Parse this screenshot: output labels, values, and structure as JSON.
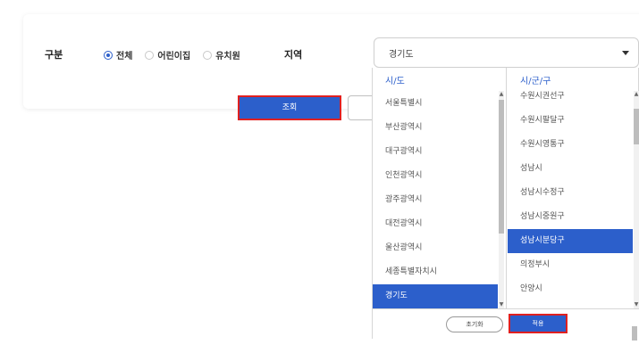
{
  "filter": {
    "category_label": "구분",
    "radio_options": [
      {
        "label": "전체",
        "checked": true
      },
      {
        "label": "어린이집",
        "checked": false
      },
      {
        "label": "유치원",
        "checked": false
      }
    ],
    "region_label": "지역",
    "region_selected": "경기도"
  },
  "buttons": {
    "search": "조회"
  },
  "dropdown": {
    "left_header": "시/도",
    "right_header": "시/군/구",
    "provinces": [
      "서울특별시",
      "부산광역시",
      "대구광역시",
      "인천광역시",
      "광주광역시",
      "대전광역시",
      "울산광역시",
      "세종특별자치시",
      "경기도"
    ],
    "selected_province": "경기도",
    "districts": [
      "수원시권선구",
      "수원시팔달구",
      "수원시영통구",
      "성남시",
      "성남시수정구",
      "성남시중원구",
      "성남시분당구",
      "의정부시",
      "안양시"
    ],
    "selected_district": "성남시분당구",
    "reset_label": "초기화",
    "apply_label": "적용"
  },
  "colors": {
    "accent": "#2c5fcb",
    "highlight_border": "#e02020"
  }
}
